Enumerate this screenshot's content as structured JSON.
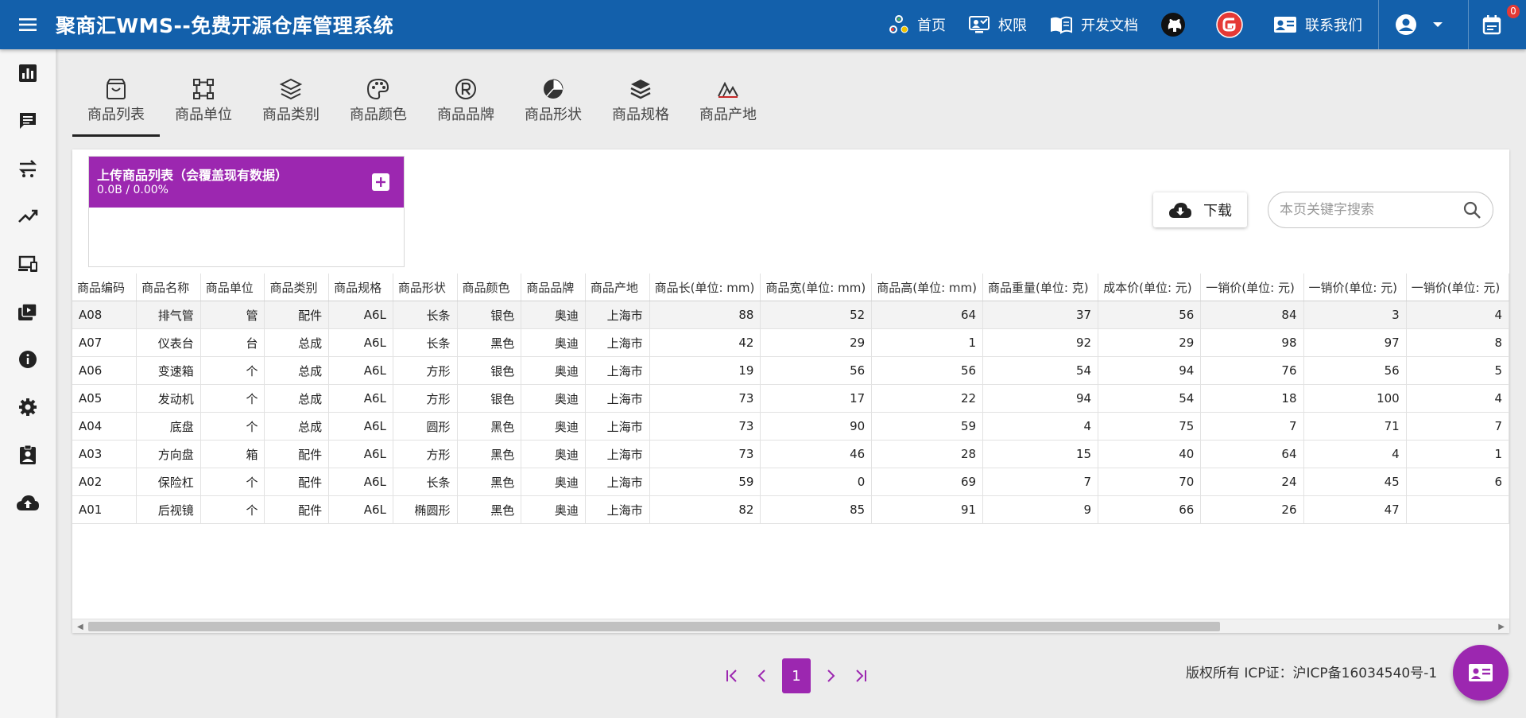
{
  "header": {
    "title": "聚商汇WMS--免费开源仓库管理系统",
    "nav": [
      {
        "label": "首页",
        "icon": "home-icon"
      },
      {
        "label": "权限",
        "icon": "permission-icon"
      },
      {
        "label": "开发文档",
        "icon": "book-icon"
      }
    ],
    "contact_label": "联系我们",
    "cart_badge": "0"
  },
  "sidebar": {
    "items": [
      "chart-icon",
      "message-icon",
      "transfer-icon",
      "trend-icon",
      "devices-icon",
      "briefcase-icon",
      "info-icon",
      "settings-icon",
      "badge-icon",
      "cloud-upload-icon"
    ]
  },
  "tabs": [
    {
      "label": "商品列表",
      "icon": "shopping-bag-icon",
      "active": true
    },
    {
      "label": "商品单位",
      "icon": "unit-icon"
    },
    {
      "label": "商品类别",
      "icon": "layers-icon"
    },
    {
      "label": "商品颜色",
      "icon": "palette-icon"
    },
    {
      "label": "商品品牌",
      "icon": "registered-icon"
    },
    {
      "label": "商品形状",
      "icon": "pie-icon"
    },
    {
      "label": "商品规格",
      "icon": "stack-icon"
    },
    {
      "label": "商品产地",
      "icon": "origin-icon"
    }
  ],
  "uploader": {
    "title": "上传商品列表（会覆盖现有数据）",
    "progress": "0.0B / 0.00%"
  },
  "toolbar": {
    "download_label": "下载",
    "search_placeholder": "本页关键字搜索"
  },
  "table": {
    "columns": [
      "商品编码",
      "商品名称",
      "商品单位",
      "商品类别",
      "商品规格",
      "商品形状",
      "商品颜色",
      "商品品牌",
      "商品产地",
      "商品长(单位: mm)",
      "商品宽(单位: mm)",
      "商品高(单位: mm)",
      "商品重量(单位: 克)",
      "成本价(单位: 元)",
      "一销价(单位: 元)",
      "一销价(单位: 元)",
      "一销价(单位: 元)"
    ],
    "rows": [
      [
        "A08",
        "排气管",
        "管",
        "配件",
        "A6L",
        "长条",
        "银色",
        "奥迪",
        "上海市",
        "88",
        "52",
        "64",
        "37",
        "56",
        "84",
        "3",
        "4"
      ],
      [
        "A07",
        "仪表台",
        "台",
        "总成",
        "A6L",
        "长条",
        "黑色",
        "奥迪",
        "上海市",
        "42",
        "29",
        "1",
        "92",
        "29",
        "98",
        "97",
        "8"
      ],
      [
        "A06",
        "变速箱",
        "个",
        "总成",
        "A6L",
        "方形",
        "银色",
        "奥迪",
        "上海市",
        "19",
        "56",
        "56",
        "54",
        "94",
        "76",
        "56",
        "5"
      ],
      [
        "A05",
        "发动机",
        "个",
        "总成",
        "A6L",
        "方形",
        "银色",
        "奥迪",
        "上海市",
        "73",
        "17",
        "22",
        "94",
        "54",
        "18",
        "100",
        "4"
      ],
      [
        "A04",
        "底盘",
        "个",
        "总成",
        "A6L",
        "圆形",
        "黑色",
        "奥迪",
        "上海市",
        "73",
        "90",
        "59",
        "4",
        "75",
        "7",
        "71",
        "7"
      ],
      [
        "A03",
        "方向盘",
        "箱",
        "配件",
        "A6L",
        "方形",
        "黑色",
        "奥迪",
        "上海市",
        "73",
        "46",
        "28",
        "15",
        "40",
        "64",
        "4",
        "1"
      ],
      [
        "A02",
        "保险杠",
        "个",
        "配件",
        "A6L",
        "长条",
        "黑色",
        "奥迪",
        "上海市",
        "59",
        "0",
        "69",
        "7",
        "70",
        "24",
        "45",
        "6"
      ],
      [
        "A01",
        "后视镜",
        "个",
        "配件",
        "A6L",
        "椭圆形",
        "黑色",
        "奥迪",
        "上海市",
        "82",
        "85",
        "91",
        "9",
        "66",
        "26",
        "47",
        ""
      ]
    ]
  },
  "pagination": {
    "current": "1"
  },
  "footer": {
    "copyright": "版权所有 ICP证：沪ICP备16034540号-1"
  },
  "colors": {
    "header": "#1360ab",
    "accent": "#9c27b0"
  }
}
